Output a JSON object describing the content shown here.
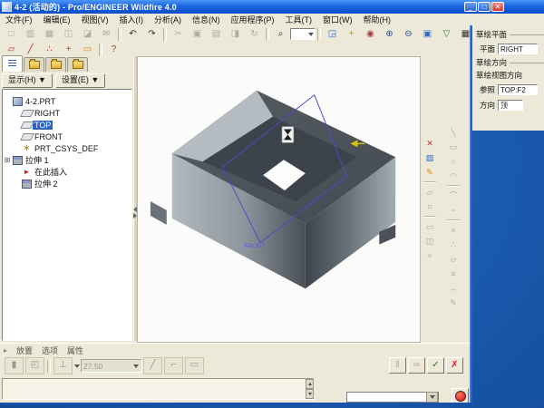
{
  "window": {
    "title": "4-2 (活动的) - Pro/ENGINEER Wildfire 4.0",
    "minimize_glyph": "_",
    "maximize_glyph": "□",
    "close_glyph": "✕"
  },
  "menu": {
    "items": [
      "文件(F)",
      "编辑(E)",
      "视图(V)",
      "插入(I)",
      "分析(A)",
      "信息(N)",
      "应用程序(P)",
      "工具(T)",
      "窗口(W)",
      "帮助(H)"
    ]
  },
  "toolbar_main": {
    "icons": [
      {
        "name": "new",
        "glyph": "□"
      },
      {
        "name": "open",
        "glyph": "▥"
      },
      {
        "name": "save",
        "glyph": "▦"
      },
      {
        "name": "print",
        "glyph": "◫"
      },
      {
        "name": "print-preview",
        "glyph": "◪"
      },
      {
        "name": "mail",
        "glyph": "✉"
      },
      {
        "name": "undo",
        "glyph": "↶"
      },
      {
        "name": "redo",
        "glyph": "↷"
      },
      {
        "name": "cut",
        "glyph": "✂"
      },
      {
        "name": "copy",
        "glyph": "▣"
      },
      {
        "name": "paste",
        "glyph": "▤"
      },
      {
        "name": "paste-special",
        "glyph": "◨"
      },
      {
        "name": "regenerate",
        "glyph": "↻"
      },
      {
        "name": "find",
        "glyph": "⌕"
      },
      {
        "name": "repaint",
        "glyph": "◲"
      },
      {
        "name": "spin-center",
        "glyph": "+"
      },
      {
        "name": "orient-mode",
        "glyph": "◉"
      },
      {
        "name": "zoom-in",
        "glyph": "⊕"
      },
      {
        "name": "zoom-out",
        "glyph": "⊖"
      },
      {
        "name": "refit",
        "glyph": "▣"
      },
      {
        "name": "saved-views",
        "glyph": "▽"
      },
      {
        "name": "view-manager",
        "glyph": "▦"
      },
      {
        "name": "layers",
        "glyph": "≡"
      },
      {
        "name": "window-extra",
        "glyph": "▭"
      }
    ]
  },
  "toolbar_datum": {
    "icons": [
      {
        "name": "datum-plane",
        "glyph": "▱"
      },
      {
        "name": "datum-axis",
        "glyph": "╱"
      },
      {
        "name": "datum-point",
        "glyph": "∴"
      },
      {
        "name": "datum-csys",
        "glyph": "+"
      },
      {
        "name": "annotation",
        "glyph": "▭"
      },
      {
        "name": "context-help",
        "glyph": "?"
      }
    ]
  },
  "navigator": {
    "show_label": "显示(H) ▼",
    "settings_label": "设置(E) ▼"
  },
  "model_tree": {
    "items": [
      {
        "label": "4-2.PRT"
      },
      {
        "label": "RIGHT"
      },
      {
        "label": "TOP",
        "selected": true
      },
      {
        "label": "FRONT"
      },
      {
        "label": "PRT_CSYS_DEF"
      },
      {
        "prefix": "⊞",
        "label": "拉伸 1"
      },
      {
        "label": "在此插入"
      },
      {
        "label": "拉伸 2"
      }
    ]
  },
  "graphics": {
    "front_label": "FRONT"
  },
  "right_toolbar_a": {
    "icons": [
      {
        "name": "hide-item",
        "glyph": "✕"
      },
      {
        "name": "appearance",
        "glyph": "▨"
      },
      {
        "name": "line-style",
        "glyph": "✎"
      },
      {
        "name": "plane-display",
        "glyph": "▱"
      },
      {
        "name": "axis-display",
        "glyph": "⌗"
      },
      {
        "name": "point-display",
        "glyph": "▭"
      },
      {
        "name": "csys-display",
        "glyph": "◫"
      },
      {
        "name": "annotation-display",
        "glyph": "≈"
      }
    ]
  },
  "right_toolbar_b": {
    "icons": [
      {
        "name": "line",
        "glyph": "╲"
      },
      {
        "name": "rectangle",
        "glyph": "▭"
      },
      {
        "name": "circle",
        "glyph": "○"
      },
      {
        "name": "arc",
        "glyph": "◠"
      },
      {
        "name": "fillet",
        "glyph": "⌒"
      },
      {
        "name": "spline",
        "glyph": "~"
      },
      {
        "name": "point",
        "glyph": "×"
      },
      {
        "name": "coord-system",
        "glyph": "∴"
      },
      {
        "name": "use-edge",
        "glyph": "▱"
      },
      {
        "name": "dimension",
        "glyph": "≡"
      },
      {
        "name": "modify",
        "glyph": "↔"
      },
      {
        "name": "trim",
        "glyph": "✎"
      }
    ]
  },
  "dashboard": {
    "feature_glyph": "▸",
    "tabs": [
      "放置",
      "选项",
      "属性"
    ],
    "icons": [
      {
        "name": "solid",
        "glyph": "▮"
      },
      {
        "name": "surface",
        "glyph": "◰"
      },
      {
        "name": "depth-blind",
        "glyph": "⊥"
      },
      {
        "name": "flip-direction",
        "glyph": "╱"
      },
      {
        "name": "remove-material",
        "glyph": "⌐"
      },
      {
        "name": "thicken",
        "glyph": "▭"
      }
    ],
    "depth_value": "27.50",
    "pause_glyph": "‖",
    "preview_glyph": "∞",
    "ok_glyph": "✓",
    "cancel_glyph": "✗"
  },
  "sketch_dialog": {
    "plane_group": "草绘平面",
    "plane_label": "平面",
    "plane_value": "RIGHT",
    "direction_group": "草绘方向",
    "view_direction_label": "草绘视图方向",
    "reference_label": "参照",
    "reference_value": "TOP:F2",
    "orientation_label": "方向",
    "orientation_value": "顶"
  },
  "palette": {
    "desktop_blue": "#1a5bb0",
    "titlebar_blue": "#0a4fc8",
    "ui_gray": "#ece9d8",
    "selection_blue": "#2a62c8",
    "model_light": "#b2b9c0",
    "model_dark": "#4a5158",
    "sketch_blue": "#4b4bd0",
    "arrow_yellow": "#d8c300",
    "close_red": "#d43b2a"
  }
}
